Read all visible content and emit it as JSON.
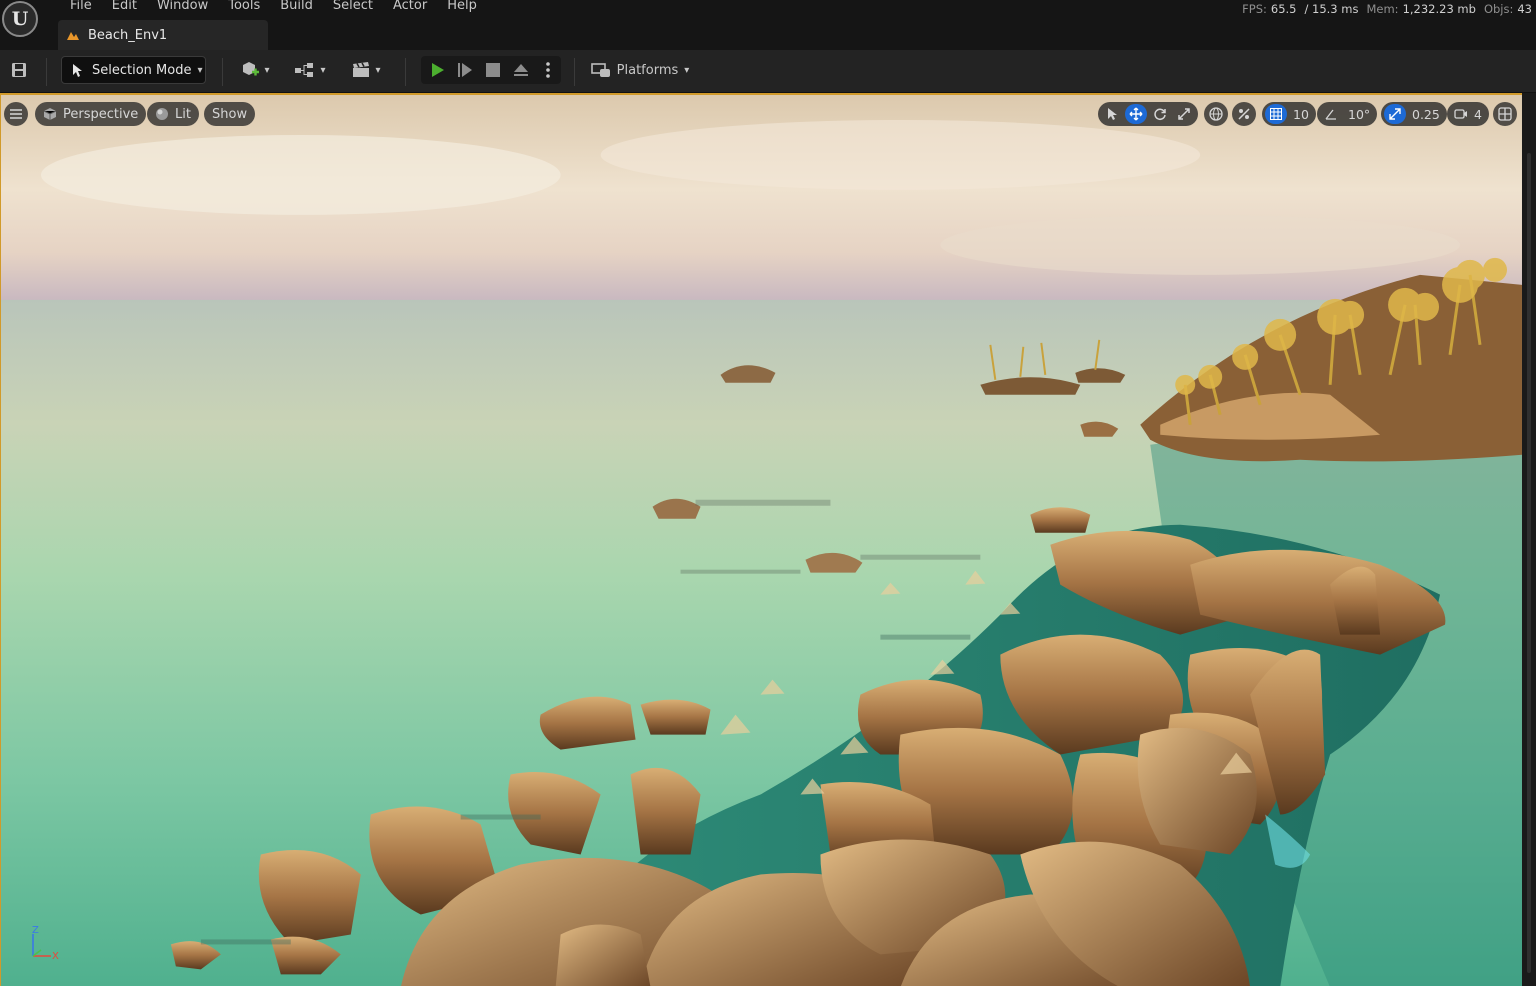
{
  "app": {
    "logo_letter": "U"
  },
  "menu": [
    "File",
    "Edit",
    "Window",
    "Tools",
    "Build",
    "Select",
    "Actor",
    "Help"
  ],
  "document_tab": {
    "label": "Beach_Env1"
  },
  "stats": {
    "fps_label": "FPS:",
    "fps_value": "65.5",
    "frame_time": "/ 15.3 ms",
    "mem_label": "Mem:",
    "mem_value": "1,232.23 mb",
    "objs_label": "Objs:",
    "objs_value": "43"
  },
  "toolbar": {
    "selection_mode_label": "Selection Mode",
    "platforms_label": "Platforms",
    "play_color": "#4caf2f"
  },
  "viewport": {
    "perspective_label": "Perspective",
    "lit_label": "Lit",
    "show_label": "Show",
    "grid_snap_value": "10",
    "rotation_snap_value": "10°",
    "scale_snap_value": "0.25",
    "camera_speed_value": "4",
    "accent_color": "#1d6ad6",
    "axis_labels": {
      "z": "Z",
      "x": "X"
    }
  }
}
